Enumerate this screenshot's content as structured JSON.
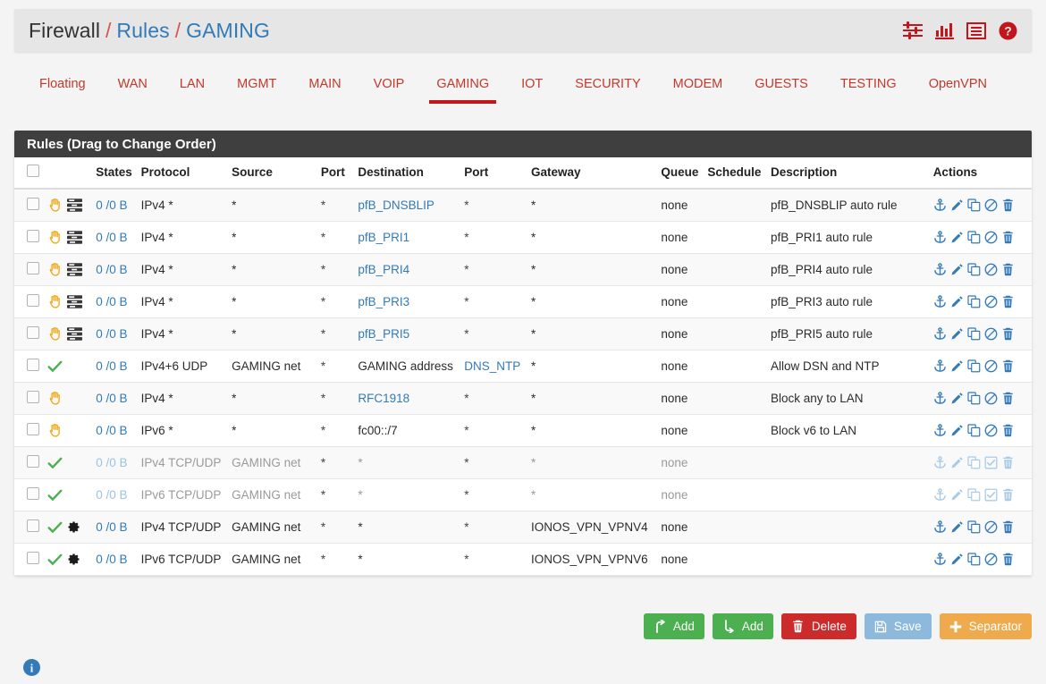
{
  "breadcrumb": {
    "root": "Firewall",
    "sep": "/",
    "section": "Rules",
    "page": "GAMING"
  },
  "header_icons": [
    {
      "name": "sliders-icon",
      "label": "Advanced filter"
    },
    {
      "name": "bar-chart-icon",
      "label": "Statistics"
    },
    {
      "name": "list-table-icon",
      "label": "Rules list view"
    },
    {
      "name": "help-circle-icon",
      "label": "Help"
    }
  ],
  "tabs": [
    {
      "label": "Floating",
      "active": false
    },
    {
      "label": "WAN",
      "active": false
    },
    {
      "label": "LAN",
      "active": false
    },
    {
      "label": "MGMT",
      "active": false
    },
    {
      "label": "MAIN",
      "active": false
    },
    {
      "label": "VOIP",
      "active": false
    },
    {
      "label": "GAMING",
      "active": true
    },
    {
      "label": "IOT",
      "active": false
    },
    {
      "label": "SECURITY",
      "active": false
    },
    {
      "label": "MODEM",
      "active": false
    },
    {
      "label": "GUESTS",
      "active": false
    },
    {
      "label": "TESTING",
      "active": false
    },
    {
      "label": "OpenVPN",
      "active": false
    }
  ],
  "panel": {
    "title": "Rules (Drag to Change Order)",
    "columns": [
      "",
      "",
      "States",
      "Protocol",
      "Source",
      "Port",
      "Destination",
      "Port",
      "Gateway",
      "Queue",
      "Schedule",
      "Description",
      "Actions"
    ]
  },
  "rows": [
    {
      "icons": [
        "block-hand-icon",
        "tasks-icon"
      ],
      "states": "0 /0 B",
      "protocol": "IPv4 *",
      "source": "*",
      "sport": "*",
      "destination": "pfB_DNSBLIP",
      "destination_link": true,
      "dport": "*",
      "gateway": "*",
      "queue": "none",
      "schedule": "",
      "description": "pfB_DNSBLIP auto rule",
      "disabled": false,
      "toggle": "ban-icon"
    },
    {
      "icons": [
        "block-hand-icon",
        "tasks-icon"
      ],
      "states": "0 /0 B",
      "protocol": "IPv4 *",
      "source": "*",
      "sport": "*",
      "destination": "pfB_PRI1",
      "destination_link": true,
      "dport": "*",
      "gateway": "*",
      "queue": "none",
      "schedule": "",
      "description": "pfB_PRI1 auto rule",
      "disabled": false,
      "toggle": "ban-icon"
    },
    {
      "icons": [
        "block-hand-icon",
        "tasks-icon"
      ],
      "states": "0 /0 B",
      "protocol": "IPv4 *",
      "source": "*",
      "sport": "*",
      "destination": "pfB_PRI4",
      "destination_link": true,
      "dport": "*",
      "gateway": "*",
      "queue": "none",
      "schedule": "",
      "description": "pfB_PRI4 auto rule",
      "disabled": false,
      "toggle": "ban-icon"
    },
    {
      "icons": [
        "block-hand-icon",
        "tasks-icon"
      ],
      "states": "0 /0 B",
      "protocol": "IPv4 *",
      "source": "*",
      "sport": "*",
      "destination": "pfB_PRI3",
      "destination_link": true,
      "dport": "*",
      "gateway": "*",
      "queue": "none",
      "schedule": "",
      "description": "pfB_PRI3 auto rule",
      "disabled": false,
      "toggle": "ban-icon"
    },
    {
      "icons": [
        "block-hand-icon",
        "tasks-icon"
      ],
      "states": "0 /0 B",
      "protocol": "IPv4 *",
      "source": "*",
      "sport": "*",
      "destination": "pfB_PRI5",
      "destination_link": true,
      "dport": "*",
      "gateway": "*",
      "queue": "none",
      "schedule": "",
      "description": "pfB_PRI5 auto rule",
      "disabled": false,
      "toggle": "ban-icon"
    },
    {
      "icons": [
        "pass-check-icon"
      ],
      "states": "0 /0 B",
      "protocol": "IPv4+6 UDP",
      "source": "GAMING net",
      "sport": "*",
      "destination": "GAMING address",
      "destination_link": false,
      "dport": "DNS_NTP",
      "dport_link": true,
      "gateway": "*",
      "queue": "none",
      "schedule": "",
      "description": "Allow DSN and NTP",
      "disabled": false,
      "toggle": "ban-icon"
    },
    {
      "icons": [
        "block-hand-icon"
      ],
      "states": "0 /0 B",
      "protocol": "IPv4 *",
      "source": "*",
      "sport": "*",
      "destination": "RFC1918",
      "destination_link": true,
      "dport": "*",
      "gateway": "*",
      "queue": "none",
      "schedule": "",
      "description": "Block any to LAN",
      "disabled": false,
      "toggle": "ban-icon"
    },
    {
      "icons": [
        "block-hand-icon"
      ],
      "states": "0 /0 B",
      "protocol": "IPv6 *",
      "source": "*",
      "sport": "*",
      "destination": "fc00::/7",
      "destination_link": false,
      "dport": "*",
      "gateway": "*",
      "queue": "none",
      "schedule": "",
      "description": "Block v6 to LAN",
      "disabled": false,
      "toggle": "ban-icon"
    },
    {
      "icons": [
        "pass-check-icon"
      ],
      "states": "0 /0 B",
      "protocol": "IPv4 TCP/UDP",
      "source": "GAMING net",
      "sport": "*",
      "destination": "*",
      "destination_link": false,
      "dport": "*",
      "gateway": "*",
      "queue": "none",
      "schedule": "",
      "description": "",
      "disabled": true,
      "toggle": "check-square-icon"
    },
    {
      "icons": [
        "pass-check-icon"
      ],
      "states": "0 /0 B",
      "protocol": "IPv6 TCP/UDP",
      "source": "GAMING net",
      "sport": "*",
      "destination": "*",
      "destination_link": false,
      "dport": "*",
      "gateway": "*",
      "queue": "none",
      "schedule": "",
      "description": "",
      "disabled": true,
      "toggle": "check-square-icon"
    },
    {
      "icons": [
        "pass-check-icon",
        "gear-icon"
      ],
      "states": "0 /0 B",
      "protocol": "IPv4 TCP/UDP",
      "source": "GAMING net",
      "sport": "*",
      "destination": "*",
      "destination_link": false,
      "dport": "*",
      "gateway": "IONOS_VPN_VPNV4",
      "queue": "none",
      "schedule": "",
      "description": "",
      "disabled": false,
      "toggle": "ban-icon"
    },
    {
      "icons": [
        "pass-check-icon",
        "gear-icon"
      ],
      "states": "0 /0 B",
      "protocol": "IPv6 TCP/UDP",
      "source": "GAMING net",
      "sport": "*",
      "destination": "*",
      "destination_link": false,
      "dport": "*",
      "gateway": "IONOS_VPN_VPNV6",
      "queue": "none",
      "schedule": "",
      "description": "",
      "disabled": false,
      "toggle": "ban-icon"
    }
  ],
  "buttons": [
    {
      "label": "Add",
      "name": "add-up-button",
      "style": "green",
      "icon": "arrow-up-icon"
    },
    {
      "label": "Add",
      "name": "add-down-button",
      "style": "green",
      "icon": "arrow-down-icon"
    },
    {
      "label": "Delete",
      "name": "delete-button",
      "style": "red",
      "icon": "trash-icon"
    },
    {
      "label": "Save",
      "name": "save-button",
      "style": "blue",
      "icon": "floppy-icon"
    },
    {
      "label": "Separator",
      "name": "separator-button",
      "style": "orange",
      "icon": "plus-icon"
    }
  ],
  "colors": {
    "accent_red": "#c0161c",
    "link_blue": "#337ab7",
    "pass_green": "#4caf50",
    "block_yellow": "#f0ad20",
    "panel_head": "#3f3f3f"
  }
}
